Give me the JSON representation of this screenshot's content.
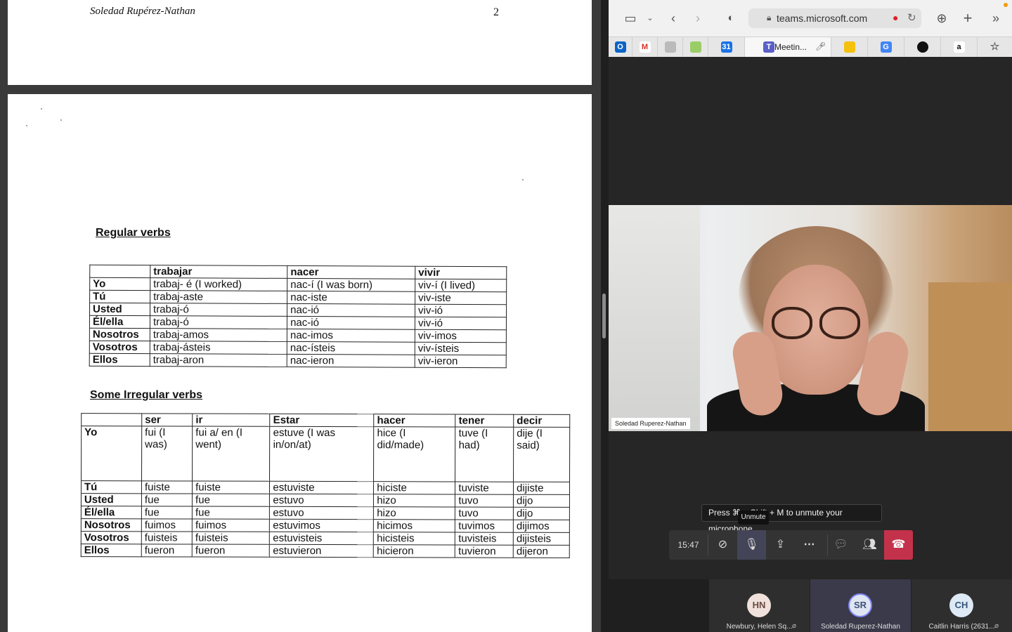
{
  "document": {
    "header_author": "Soledad Rupérez-Nathan",
    "header_page": "2",
    "regular_title": "Regular verbs",
    "regular_table": {
      "headers": [
        "",
        "trabajar",
        "nacer",
        "vivir"
      ],
      "rows": [
        [
          "Yo",
          "trabaj- é (I worked)",
          "nac-í (I was born)",
          "viv-í (I lived)"
        ],
        [
          "Tú",
          "trabaj-aste",
          "nac-iste",
          "viv-iste"
        ],
        [
          "Usted",
          "trabaj-ó",
          "nac-ió",
          "viv-ió"
        ],
        [
          "Él/ella",
          "trabaj-ó",
          "nac-ió",
          "viv-ió"
        ],
        [
          "Nosotros",
          "trabaj-amos",
          "nac-imos",
          "viv-imos"
        ],
        [
          "Vosotros",
          "trabaj-ásteis",
          "nac-ísteis",
          "viv-ísteis"
        ],
        [
          "Ellos",
          "trabaj-aron",
          "nac-ieron",
          "viv-ieron"
        ]
      ]
    },
    "irregular_title": "Some Irregular verbs",
    "irregular_table": {
      "headers": [
        "",
        "ser",
        "ir",
        "Estar",
        "hacer",
        "tener",
        "decir"
      ],
      "rows": [
        [
          "Yo",
          "fui (I was)",
          "fui a/ en (I went)",
          "estuve (I was in/on/at)",
          "hice (I did/made)",
          "tuve (I had)",
          "dije (I said)"
        ],
        [
          "Tú",
          "fuiste",
          "fuiste",
          "estuviste",
          "hiciste",
          "tuviste",
          "dijiste"
        ],
        [
          "Usted",
          "fue",
          "fue",
          "estuvo",
          "hizo",
          "tuvo",
          "dijo"
        ],
        [
          "Él/ella",
          "fue",
          "fue",
          "estuvo",
          "hizo",
          "tuvo",
          "dijo"
        ],
        [
          "Nosotros",
          "fuimos",
          "fuimos",
          "estuvimos",
          "hicimos",
          "tuvimos",
          "dijimos"
        ],
        [
          "Vosotros",
          "fuisteis",
          "fuisteis",
          "estuvisteis",
          "hicisteis",
          "tuvisteis",
          "dijisteis"
        ],
        [
          "Ellos",
          "fueron",
          "fueron",
          "estuvieron",
          "hicieron",
          "tuvieron",
          "dijeron"
        ]
      ]
    }
  },
  "browser": {
    "url": "teams.microsoft.com",
    "active_tab_title": "Meetin...",
    "favicons": [
      "outlook-icon",
      "gmail-icon",
      "site-icon",
      "maps-icon",
      "calendar-icon",
      "teams-icon",
      "keep-icon",
      "translate-icon",
      "github-icon",
      "amazon-icon",
      "star-icon"
    ]
  },
  "meeting": {
    "speaker_name": "Soledad Ruperez-Nathan",
    "tooltip_text": "Press ⌘ + Shift + M to unmute your microphone.",
    "unmute_label": "Unmute",
    "call_time": "15:47",
    "participants": [
      {
        "initials": "HN",
        "name": "Newbury, Helen Sq...",
        "color": "#f0e1dc",
        "text": "#6b4a40"
      },
      {
        "initials": "SR",
        "name": "Soledad Ruperez-Nathan",
        "color": "#dfe6f2",
        "text": "#3f5277"
      },
      {
        "initials": "CH",
        "name": "Caitlin Harris (2631...",
        "color": "#dde9f5",
        "text": "#36557a"
      }
    ]
  }
}
